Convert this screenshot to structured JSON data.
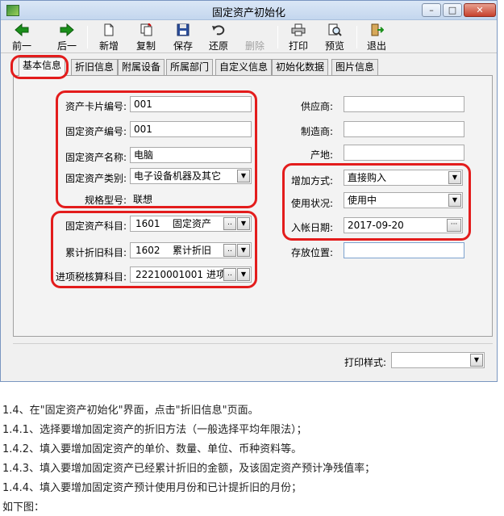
{
  "window": {
    "title": "固定资产初始化",
    "controls": {
      "minimize": "–",
      "maximize": "□",
      "close": "✕"
    }
  },
  "toolbar": {
    "prev": "前一",
    "next": "后一",
    "add": "新增",
    "copy": "复制",
    "save": "保存",
    "restore": "还原",
    "delete": "删除",
    "print": "打印",
    "preview": "预览",
    "exit": "退出"
  },
  "tabs": [
    "基本信息",
    "折旧信息",
    "附属设备",
    "所属部门",
    "自定义信息",
    "初始化数据",
    "图片信息"
  ],
  "form": {
    "card_no_label": "资产卡片编号:",
    "card_no": "001",
    "asset_no_label": "固定资产编号:",
    "asset_no": "001",
    "asset_name_label": "固定资产名称:",
    "asset_name": "电脑",
    "category_label": "固定资产类别:",
    "category": "电子设备机器及其它",
    "model_label": "规格型号:",
    "model": "联想",
    "account_label": "固定资产科目:",
    "account_code": "1601",
    "account_name": "固定资产",
    "depr_account_label": "累计折旧科目:",
    "depr_account_code": "1602",
    "depr_account_name": "累计折旧",
    "tax_account_label": "进项税核算科目:",
    "tax_account_code": "22210001001",
    "tax_account_name": "进项",
    "supplier_label": "供应商:",
    "supplier": "",
    "manufacturer_label": "制造商:",
    "manufacturer": "",
    "origin_label": "产地:",
    "origin": "",
    "add_method_label": "增加方式:",
    "add_method": "直接购入",
    "use_status_label": "使用状况:",
    "use_status": "使用中",
    "entry_date_label": "入帐日期:",
    "entry_date": "2017-09-20",
    "location_label": "存放位置:",
    "location": ""
  },
  "footer": {
    "print_style_label": "打印样式:",
    "print_style": ""
  },
  "instructions": [
    "1.4、在\"固定资产初始化\"界面，点击\"折旧信息\"页面。",
    "1.4.1、选择要增加固定资产的折旧方法（一般选择平均年限法）；",
    "1.4.2、填入要增加固定资产的单价、数量、单位、币种资料等。",
    "1.4.3、填入要增加固定资产已经累计折旧的金额，及该固定资产预计净残值率；",
    "1.4.4、填入要增加固定资产预计使用月份和已计提折旧的月份；",
    "如下图："
  ],
  "colors": {
    "highlight": "#e31c1c",
    "title_bar": "#c3d6ee",
    "arrow_green": "#1a8f1a"
  }
}
